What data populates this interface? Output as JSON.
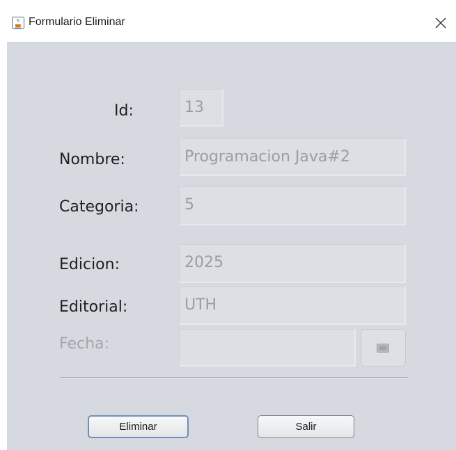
{
  "window": {
    "title": "Formulario Eliminar",
    "app_icon": "java-cup-icon",
    "close_icon": "close-icon"
  },
  "form": {
    "id_label": "Id:",
    "id_value": "13",
    "nombre_label": "Nombre:",
    "nombre_value": "Programacion Java#2",
    "categoria_label": "Categoria:",
    "categoria_value": "5",
    "edicion_label": "Edicion:",
    "edicion_value": "2025",
    "editorial_label": "Editorial:",
    "editorial_value": "UTH",
    "fecha_label": "Fecha:",
    "fecha_value": "",
    "date_picker_icon": "calendar-icon"
  },
  "buttons": {
    "eliminar": "Eliminar",
    "salir": "Salir"
  },
  "colors": {
    "window_bg": "#d6d9df",
    "titlebar_bg": "#ffffff",
    "disabled_text": "#9a9da2",
    "focus_border": "#6f8fb8"
  }
}
